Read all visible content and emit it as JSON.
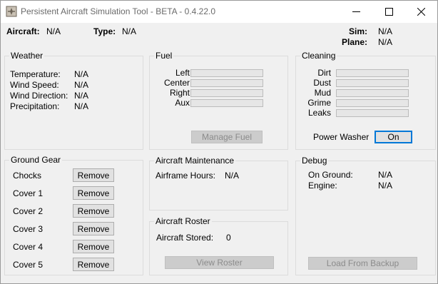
{
  "window": {
    "title": "Persistent Aircraft Simulation Tool - BETA - 0.4.22.0"
  },
  "header": {
    "aircraft_label": "Aircraft:",
    "aircraft_value": "N/A",
    "type_label": "Type:",
    "type_value": "N/A",
    "sim_label": "Sim:",
    "sim_value": "N/A",
    "plane_label": "Plane:",
    "plane_value": "N/A"
  },
  "weather": {
    "title": "Weather",
    "rows": [
      {
        "label": "Temperature:",
        "value": "N/A"
      },
      {
        "label": "Wind Speed:",
        "value": "N/A"
      },
      {
        "label": "Wind Direction:",
        "value": "N/A"
      },
      {
        "label": "Precipitation:",
        "value": "N/A"
      }
    ]
  },
  "fuel": {
    "title": "Fuel",
    "tanks": [
      {
        "label": "Left"
      },
      {
        "label": "Center"
      },
      {
        "label": "Right"
      },
      {
        "label": "Aux"
      }
    ],
    "manage_button": "Manage Fuel"
  },
  "cleaning": {
    "title": "Cleaning",
    "items": [
      {
        "label": "Dirt"
      },
      {
        "label": "Dust"
      },
      {
        "label": "Mud"
      },
      {
        "label": "Grime"
      },
      {
        "label": "Leaks"
      }
    ],
    "power_washer_label": "Power Washer",
    "power_washer_button": "On"
  },
  "ground_gear": {
    "title": "Ground Gear",
    "items": [
      {
        "label": "Chocks",
        "button": "Remove"
      },
      {
        "label": "Cover 1",
        "button": "Remove"
      },
      {
        "label": "Cover 2",
        "button": "Remove"
      },
      {
        "label": "Cover 3",
        "button": "Remove"
      },
      {
        "label": "Cover 4",
        "button": "Remove"
      },
      {
        "label": "Cover 5",
        "button": "Remove"
      }
    ]
  },
  "maintenance": {
    "title": "Aircraft Maintenance",
    "airframe_label": "Airframe Hours:",
    "airframe_value": "N/A"
  },
  "roster": {
    "title": "Aircraft Roster",
    "stored_label": "Aircraft Stored:",
    "stored_value": "0",
    "view_button": "View Roster"
  },
  "debug": {
    "title": "Debug",
    "on_ground_label": "On Ground:",
    "on_ground_value": "N/A",
    "engine_label": "Engine:",
    "engine_value": "N/A",
    "backup_button": "Load From Backup"
  }
}
